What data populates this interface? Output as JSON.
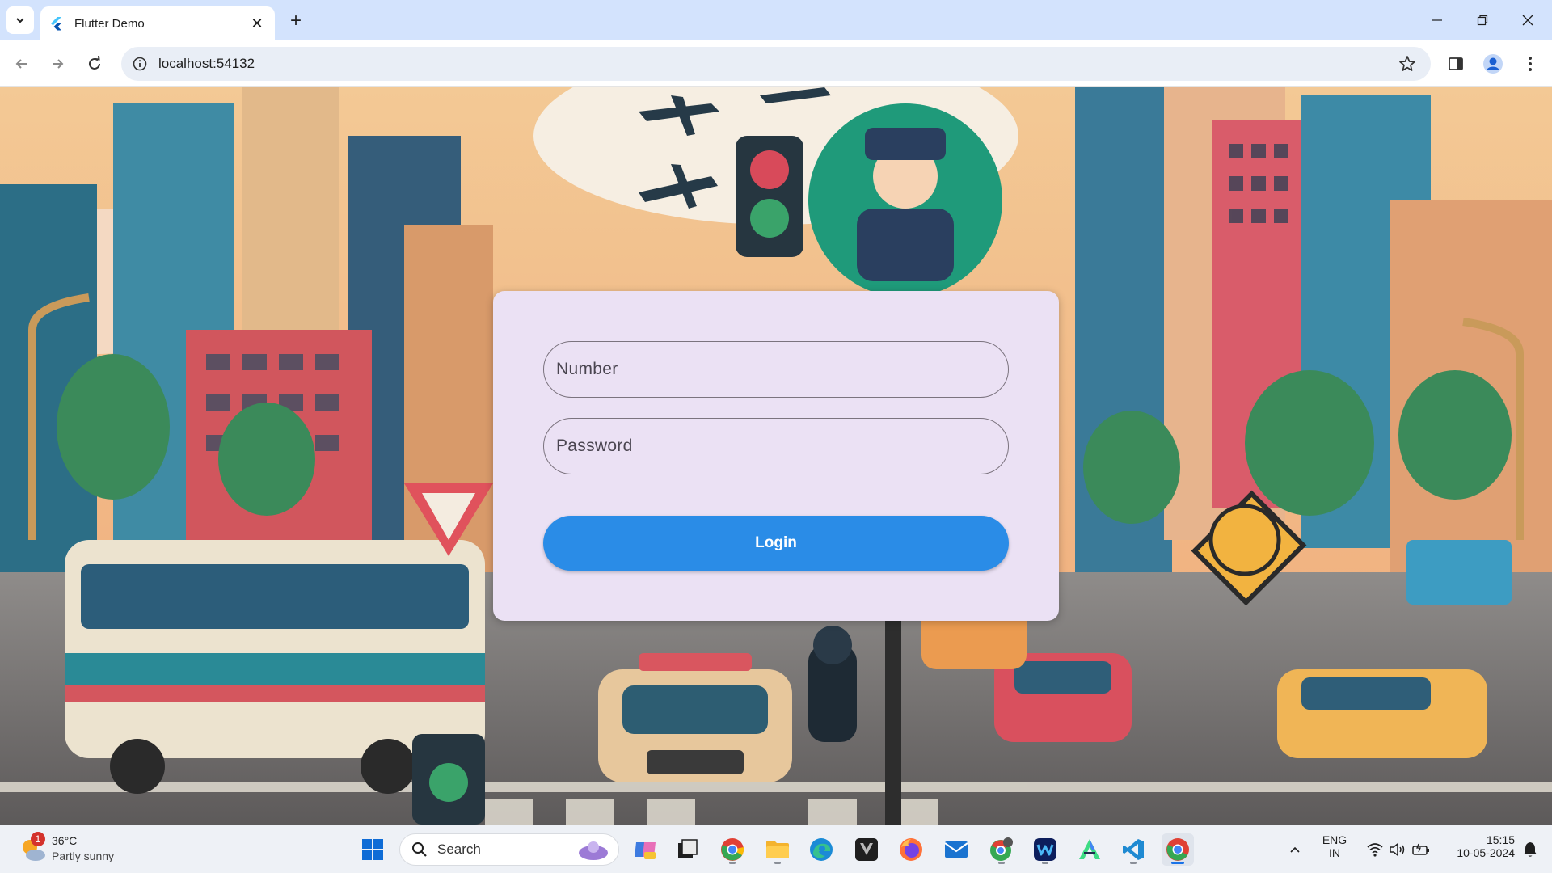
{
  "browser": {
    "tab_title": "Flutter Demo",
    "url": "localhost:54132"
  },
  "login_form": {
    "number_placeholder": "Number",
    "password_placeholder": "Password",
    "login_label": "Login"
  },
  "taskbar": {
    "weather_temp": "36°C",
    "weather_desc": "Partly sunny",
    "weather_badge": "1",
    "search_label": "Search",
    "language_line1": "ENG",
    "language_line2": "IN",
    "time": "15:15",
    "date": "10-05-2024"
  },
  "colors": {
    "login_button": "#2a8ce7",
    "card_background": "#ebe1f4",
    "tabstrip": "#d3e3fd"
  }
}
